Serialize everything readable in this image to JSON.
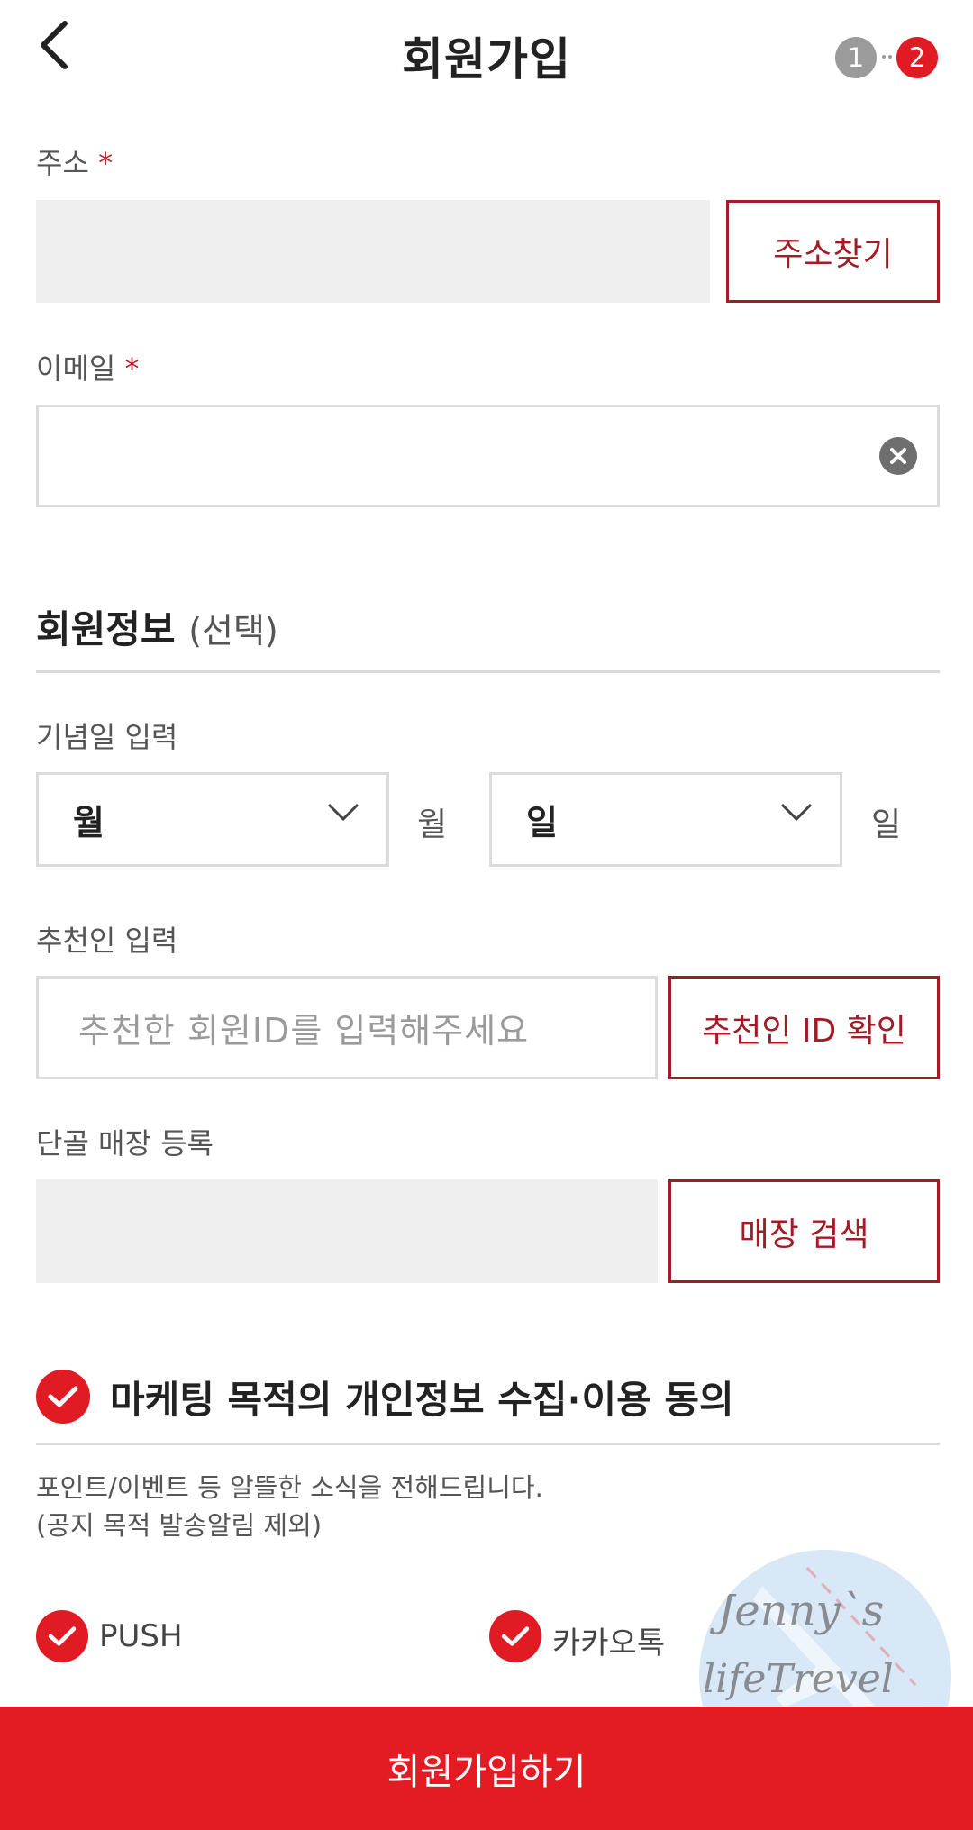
{
  "header": {
    "title": "회원가입",
    "steps": [
      "1",
      "2"
    ],
    "active_step": "2"
  },
  "address": {
    "label": "주소",
    "required_mark": "*",
    "search_button": "주소찾기"
  },
  "email": {
    "label": "이메일",
    "required_mark": "*"
  },
  "member_info": {
    "title": "회원정보",
    "optional": "(선택)"
  },
  "anniversary": {
    "label": "기념일 입력",
    "month_select": "월",
    "month_unit": "월",
    "day_select": "일",
    "day_unit": "일"
  },
  "referrer": {
    "label": "추천인 입력",
    "placeholder": "추천한 회원ID를 입력해주세요",
    "confirm_button": "추천인 ID 확인"
  },
  "store": {
    "label": "단골 매장 등록",
    "search_button": "매장 검색"
  },
  "marketing": {
    "title": "마케팅 목적의 개인정보 수집·이용 동의",
    "desc_line1": "포인트/이벤트 등 알뜰한 소식을 전해드립니다.",
    "desc_line2": "(공지 목적 발송알림 제외)",
    "options": [
      {
        "label": "PUSH",
        "checked": true
      },
      {
        "label": "카카오톡",
        "checked": true
      }
    ]
  },
  "submit": {
    "label": "회원가입하기"
  },
  "watermark": {
    "line1": "Jenny`s",
    "line2": "lifeTrevel"
  },
  "colors": {
    "accent": "#e31b23",
    "outline": "#a31b25"
  }
}
